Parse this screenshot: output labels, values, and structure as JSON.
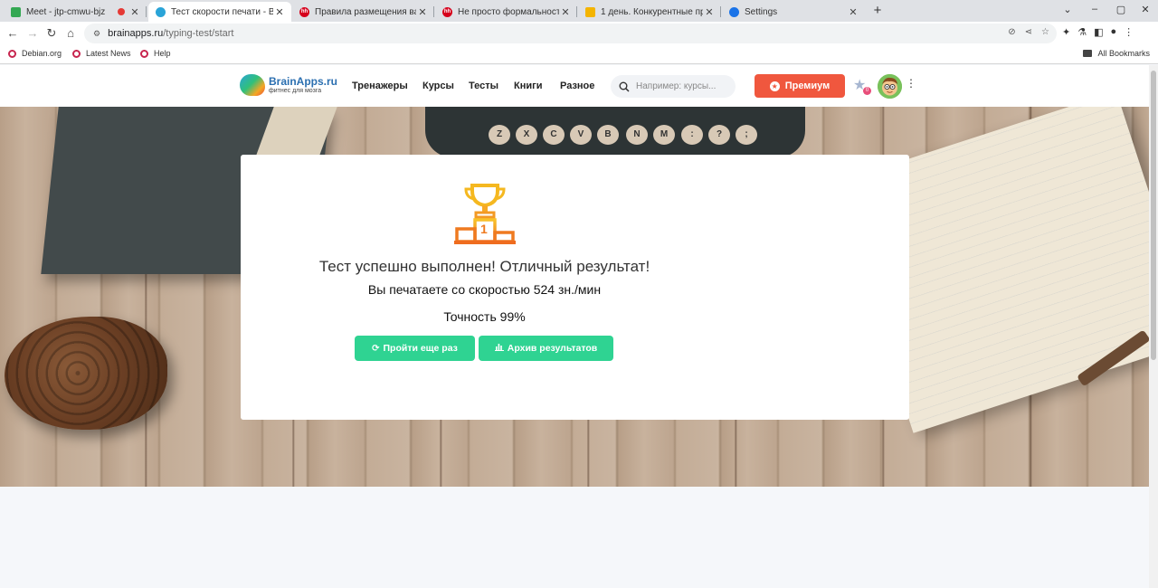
{
  "browser": {
    "tabs": [
      {
        "title": "Meet - jtp-cmwu-bjz",
        "favicon_color": "#34a853",
        "recording": true,
        "active": false
      },
      {
        "title": "Тест скорости печати - Brai",
        "favicon_color": "#2aa4d8",
        "recording": false,
        "active": true
      },
      {
        "title": "Правила размещения вака",
        "favicon_color": "#d6001c",
        "favicon_text": "hh",
        "recording": false,
        "active": false
      },
      {
        "title": "Не просто формальность:",
        "favicon_color": "#d6001c",
        "favicon_text": "hh",
        "recording": false,
        "active": false
      },
      {
        "title": "1 день. Конкурентные пре",
        "favicon_color": "#f4b400",
        "recording": false,
        "active": false
      },
      {
        "title": "Settings",
        "favicon_color": "#1a73e8",
        "recording": false,
        "active": false
      }
    ],
    "url": {
      "host": "brainapps.ru",
      "path": "/typing-test/start"
    },
    "bookmarks": [
      "Debian.org",
      "Latest News",
      "Help"
    ],
    "all_bookmarks": "All Bookmarks"
  },
  "site": {
    "logo": {
      "name": "BrainApps.ru",
      "tagline": "фитнес для мозга"
    },
    "menu": [
      "Тренажеры",
      "Курсы",
      "Тесты",
      "Книги",
      "Разное"
    ],
    "search_placeholder": "Например: курсы...",
    "premium_label": "Премиум",
    "favorites_count": "0"
  },
  "hero": {
    "typewriter_keys": [
      "Z",
      "X",
      "C",
      "V",
      "B",
      "N",
      "M",
      ":",
      "?",
      ";"
    ]
  },
  "result": {
    "title": "Тест успешно выполнен! Отличный результат!",
    "speed_text": "Вы печатаете со скоростью 524 зн./мин",
    "accuracy_text": "Точность 99%",
    "trophy_place": "1",
    "retry_label": "Пройти еще раз",
    "archive_label": "Архив результатов"
  },
  "colors": {
    "accent_green": "#2fd392",
    "premium_red": "#f0573e",
    "trophy_gold": "#f5a623",
    "trophy_orange": "#ef6c1f"
  }
}
